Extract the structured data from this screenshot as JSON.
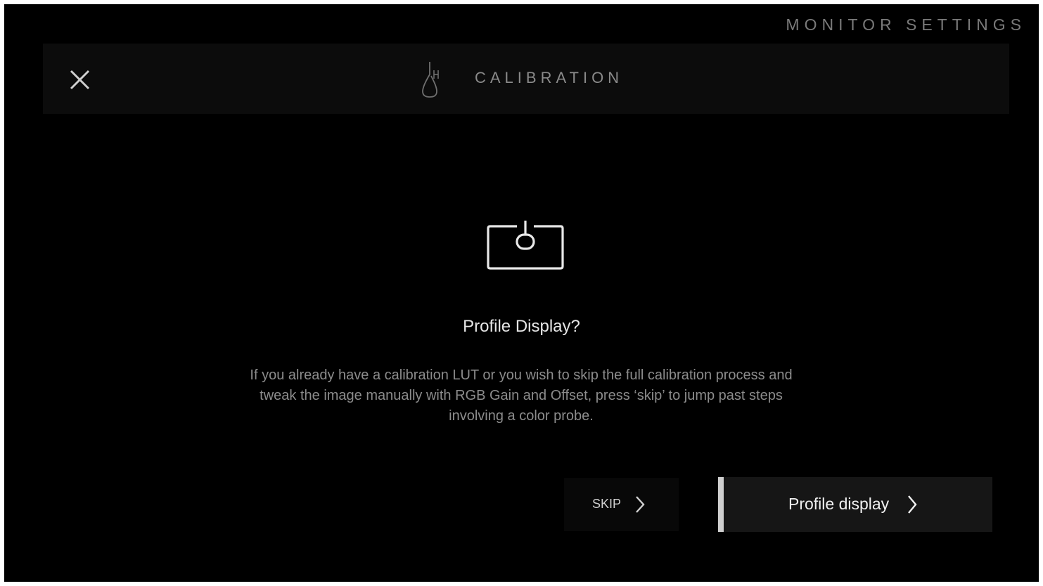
{
  "app": {
    "title": "MONITOR SETTINGS"
  },
  "header": {
    "title": "CALIBRATION",
    "close_icon": "close-icon",
    "section_icon": "calibration-probe-icon"
  },
  "dialog": {
    "icon": "color-probe-display-icon",
    "title": "Profile Display?",
    "body": "If you already have a calibration LUT or you wish to skip the full calibration process and tweak the image manually with RGB Gain and Offset, press ‘skip’ to jump past steps involving a color probe."
  },
  "actions": {
    "skip_label": "SKIP",
    "primary_label": "Profile display",
    "chevron_icon": "chevron-right-icon"
  },
  "colors": {
    "background": "#000000",
    "header_bar": "#0c0c0c",
    "primary_button": "#161616",
    "accent": "#cfcfcf"
  }
}
